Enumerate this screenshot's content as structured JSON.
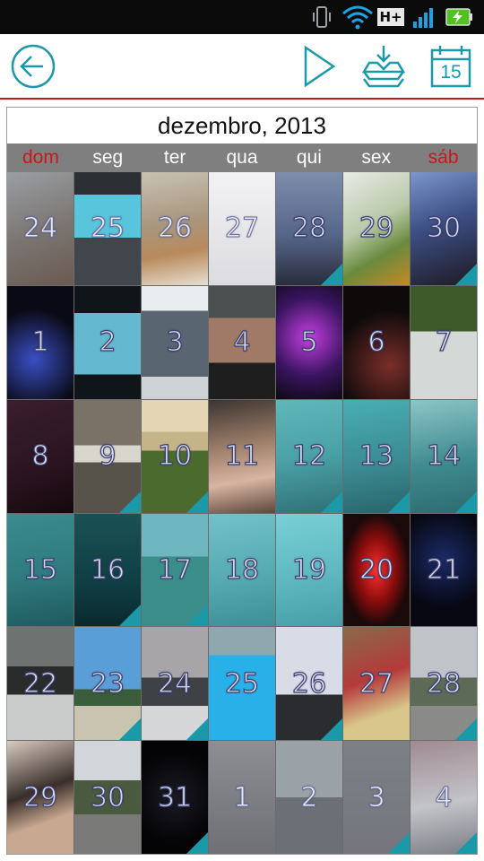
{
  "status_bar": {
    "network": "H+",
    "icons": [
      "vibrate-icon",
      "wifi-icon",
      "network-type-icon",
      "signal-icon",
      "battery-charging-icon"
    ]
  },
  "toolbar": {
    "icons": [
      "back-arrow-icon",
      "play-icon",
      "import-tray-icon",
      "calendar-today-icon"
    ],
    "calendar_day": "15",
    "accent_color": "#1a9aa8",
    "divider_color": "#c8151b"
  },
  "calendar": {
    "month_title": "dezembro, 2013",
    "weekdays": [
      {
        "label": "dom",
        "color": "#d0141c"
      },
      {
        "label": "seg",
        "color": "#ffffff"
      },
      {
        "label": "ter",
        "color": "#ffffff"
      },
      {
        "label": "qua",
        "color": "#ffffff"
      },
      {
        "label": "qui",
        "color": "#ffffff"
      },
      {
        "label": "sex",
        "color": "#ffffff"
      },
      {
        "label": "sáb",
        "color": "#d0141c"
      }
    ],
    "days": [
      {
        "day": "24",
        "current": false,
        "marked": false,
        "bg": "linear-gradient(160deg,#9a9ea3,#7a7470 55%,#6b5a52)"
      },
      {
        "day": "25",
        "current": false,
        "marked": false,
        "bg": "linear-gradient(180deg,#2c2f33 0 20%,#58c5dc 20% 58%,#40464b 58%)"
      },
      {
        "day": "26",
        "current": false,
        "marked": false,
        "bg": "linear-gradient(170deg,#c8c2b3,#a9967e 45%,#b88a5c 70%,#e6dfd2)"
      },
      {
        "day": "27",
        "current": false,
        "marked": false,
        "bg": "linear-gradient(180deg,#f2f2f4,#dcdce0)"
      },
      {
        "day": "28",
        "current": true,
        "marked": true,
        "bg": "linear-gradient(180deg,#7f8dac,#56668a 55%,#2a2e3c)"
      },
      {
        "day": "29",
        "current": true,
        "marked": false,
        "bg": "linear-gradient(150deg,#e8ece8,#b9c9a8 45%,#6a8a3e 70%,#c48a22)"
      },
      {
        "day": "30",
        "current": true,
        "marked": true,
        "bg": "linear-gradient(160deg,#7c96cc,#3c4f84 45%,#1e1a22)"
      },
      {
        "day": "1",
        "current": true,
        "marked": false,
        "bg": "radial-gradient(circle at 40% 65%,#3a4fc4,#0a0a16 60%)"
      },
      {
        "day": "2",
        "current": true,
        "marked": false,
        "bg": "linear-gradient(180deg,#0f1518 0 24%,#64b8d0 24% 78%,#0f1518 78%)"
      },
      {
        "day": "3",
        "current": true,
        "marked": false,
        "bg": "linear-gradient(180deg,#e8eef0 0 22%,#5a6572 22% 80%,#cdd3d6 80%)"
      },
      {
        "day": "4",
        "current": true,
        "marked": false,
        "bg": "linear-gradient(180deg,#4a4f4f 0 28%,#a07a66 28% 68%,#1e1e1e 68%)"
      },
      {
        "day": "5",
        "current": true,
        "marked": false,
        "bg": "radial-gradient(circle at 50% 45%,#c33fe0,#3a1460 55%,#0c0a12)"
      },
      {
        "day": "6",
        "current": true,
        "marked": false,
        "bg": "radial-gradient(circle at 70% 70%,#7a2e2a,#0e0a0a 60%)"
      },
      {
        "day": "7",
        "current": true,
        "marked": false,
        "bg": "linear-gradient(180deg,#3e5a2a 0 40%,#d4d8d6 40%)"
      },
      {
        "day": "8",
        "current": true,
        "marked": false,
        "bg": "linear-gradient(160deg,#3a1e2e,#2a1420 60%,#14080c)"
      },
      {
        "day": "9",
        "current": true,
        "marked": true,
        "bg": "linear-gradient(180deg,#7a7266 0 40%,#d8d6cc 40% 55%,#57524a 55%)"
      },
      {
        "day": "10",
        "current": true,
        "marked": true,
        "bg": "linear-gradient(180deg,#e4d6b4 0 28%,#c4b488 28% 45%,#4a6a2e 45%)"
      },
      {
        "day": "11",
        "current": true,
        "marked": false,
        "bg": "linear-gradient(170deg,#3c3430,#a68670 45%,#d8b4a2 70%,#5c463a)"
      },
      {
        "day": "12",
        "current": true,
        "marked": true,
        "bg": "linear-gradient(170deg,#5fb7ba,#4aa2a6 50%,#2f6f76)"
      },
      {
        "day": "13",
        "current": true,
        "marked": true,
        "bg": "linear-gradient(170deg,#48aeb4,#3c8c93 55%,#29646b)"
      },
      {
        "day": "14",
        "current": true,
        "marked": true,
        "bg": "linear-gradient(170deg,#8cc5c7,#3f8b8f 55%,#2c6b70)"
      },
      {
        "day": "15",
        "current": true,
        "marked": false,
        "bg": "linear-gradient(170deg,#3a8c8e,#2f7a7e 55%,#1f5a5e)"
      },
      {
        "day": "16",
        "current": true,
        "marked": true,
        "bg": "linear-gradient(180deg,#1a5156,#0f3f44 60%,#0a2a2e)"
      },
      {
        "day": "17",
        "current": true,
        "marked": true,
        "bg": "linear-gradient(180deg,#6fb7c0 0 38%,#3b8e8a 38%)"
      },
      {
        "day": "18",
        "current": true,
        "marked": false,
        "bg": "linear-gradient(170deg,#72c2c8,#56aab2 55%,#3e8f97)"
      },
      {
        "day": "19",
        "current": true,
        "marked": false,
        "bg": "linear-gradient(170deg,#79cfd6,#5fb8c0 55%,#469ea7)"
      },
      {
        "day": "20",
        "current": true,
        "marked": false,
        "bg": "radial-gradient(ellipse at 50% 50%,#ff3030,#8a0c0c 40%,#1a0a0a 70%)"
      },
      {
        "day": "21",
        "current": true,
        "marked": false,
        "bg": "radial-gradient(circle at 50% 40%,#1a2a66,#070812 65%)"
      },
      {
        "day": "22",
        "current": true,
        "marked": false,
        "bg": "linear-gradient(180deg,#6e7270 0 35%,#2a2c2c 35% 60%,#c9cccb 60%)"
      },
      {
        "day": "23",
        "current": true,
        "marked": true,
        "bg": "linear-gradient(180deg,#5a9ed8 0 55%,#3a5c3a 55% 70%,#c8c4b0 70%)"
      },
      {
        "day": "24",
        "current": true,
        "marked": true,
        "bg": "linear-gradient(180deg,#a7a5a8 0 45%,#3e4246 45% 70%,#d4d6d8 70%)"
      },
      {
        "day": "25",
        "current": true,
        "marked": false,
        "bg": "linear-gradient(180deg,#8fa8b0 0 25%,#2ab0e8 25%)"
      },
      {
        "day": "26",
        "current": true,
        "marked": true,
        "bg": "linear-gradient(180deg,#d8dce6 0 60%,#2a2c30 60%)"
      },
      {
        "day": "27",
        "current": true,
        "marked": false,
        "bg": "linear-gradient(160deg,#8a6a4a,#b43a3a 45%,#d8c68a 75%)"
      },
      {
        "day": "28",
        "current": true,
        "marked": true,
        "bg": "linear-gradient(180deg,#c0c4c8 0 45%,#5c6a56 45% 70%,#8a8a88 70%)"
      },
      {
        "day": "29",
        "current": true,
        "marked": false,
        "bg": "linear-gradient(160deg,#d8ccc0,#3a2e2a 45%,#c8a890 70%)"
      },
      {
        "day": "30",
        "current": true,
        "marked": false,
        "bg": "linear-gradient(180deg,#d2d6da 0 35%,#4a5a3e 35% 65%,#7a7a78 65%)"
      },
      {
        "day": "31",
        "current": true,
        "marked": true,
        "bg": "radial-gradient(circle at 50% 50%,#1a1a22,#040406 70%)"
      },
      {
        "day": "1",
        "current": false,
        "marked": false,
        "bg": "linear-gradient(180deg,#8d8e94,#6e7076)"
      },
      {
        "day": "2",
        "current": false,
        "marked": false,
        "bg": "linear-gradient(180deg,#9aa2a8 0 50%,#6c7076 50%)"
      },
      {
        "day": "3",
        "current": false,
        "marked": true,
        "bg": "linear-gradient(180deg,#7e8088,#74767c)"
      },
      {
        "day": "4",
        "current": false,
        "marked": true,
        "bg": "linear-gradient(170deg,#a08a92,#c2c4c8 55%,#7c7e86)"
      }
    ]
  }
}
